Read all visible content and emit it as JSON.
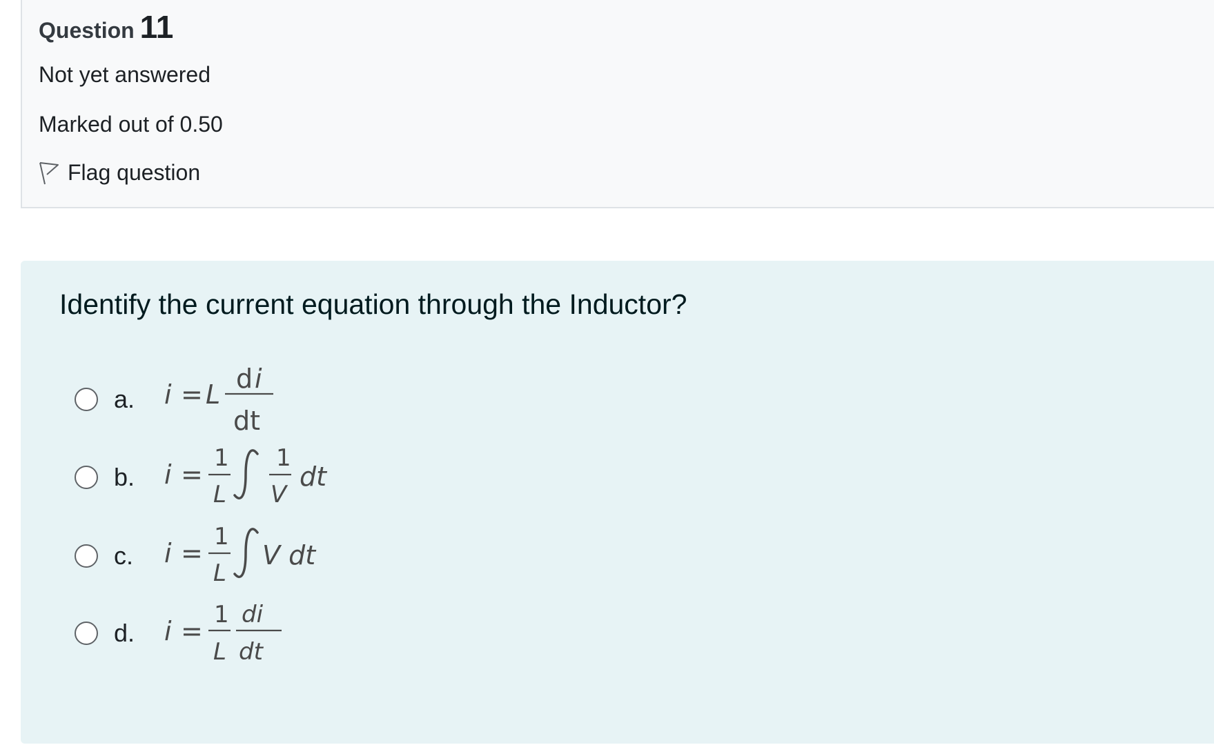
{
  "question_info": {
    "label": "Question",
    "number": "11",
    "state": "Not yet answered",
    "grade": "Marked out of 0.50",
    "flag_label": "Flag question"
  },
  "question": {
    "prompt": "Identify the current equation through the Inductor?",
    "options": [
      {
        "letter": "a.",
        "formula": "i = L di/dt"
      },
      {
        "letter": "b.",
        "formula": "i = 1/L ∫ 1/V dt"
      },
      {
        "letter": "c.",
        "formula": "i = 1/L ∫ V dt"
      },
      {
        "letter": "d.",
        "formula": "i = 1/L di/dt"
      }
    ]
  },
  "colors": {
    "info_background": "#f8f9fa",
    "question_background": "#e7f3f5",
    "formula_text": "#4a4a4a"
  }
}
